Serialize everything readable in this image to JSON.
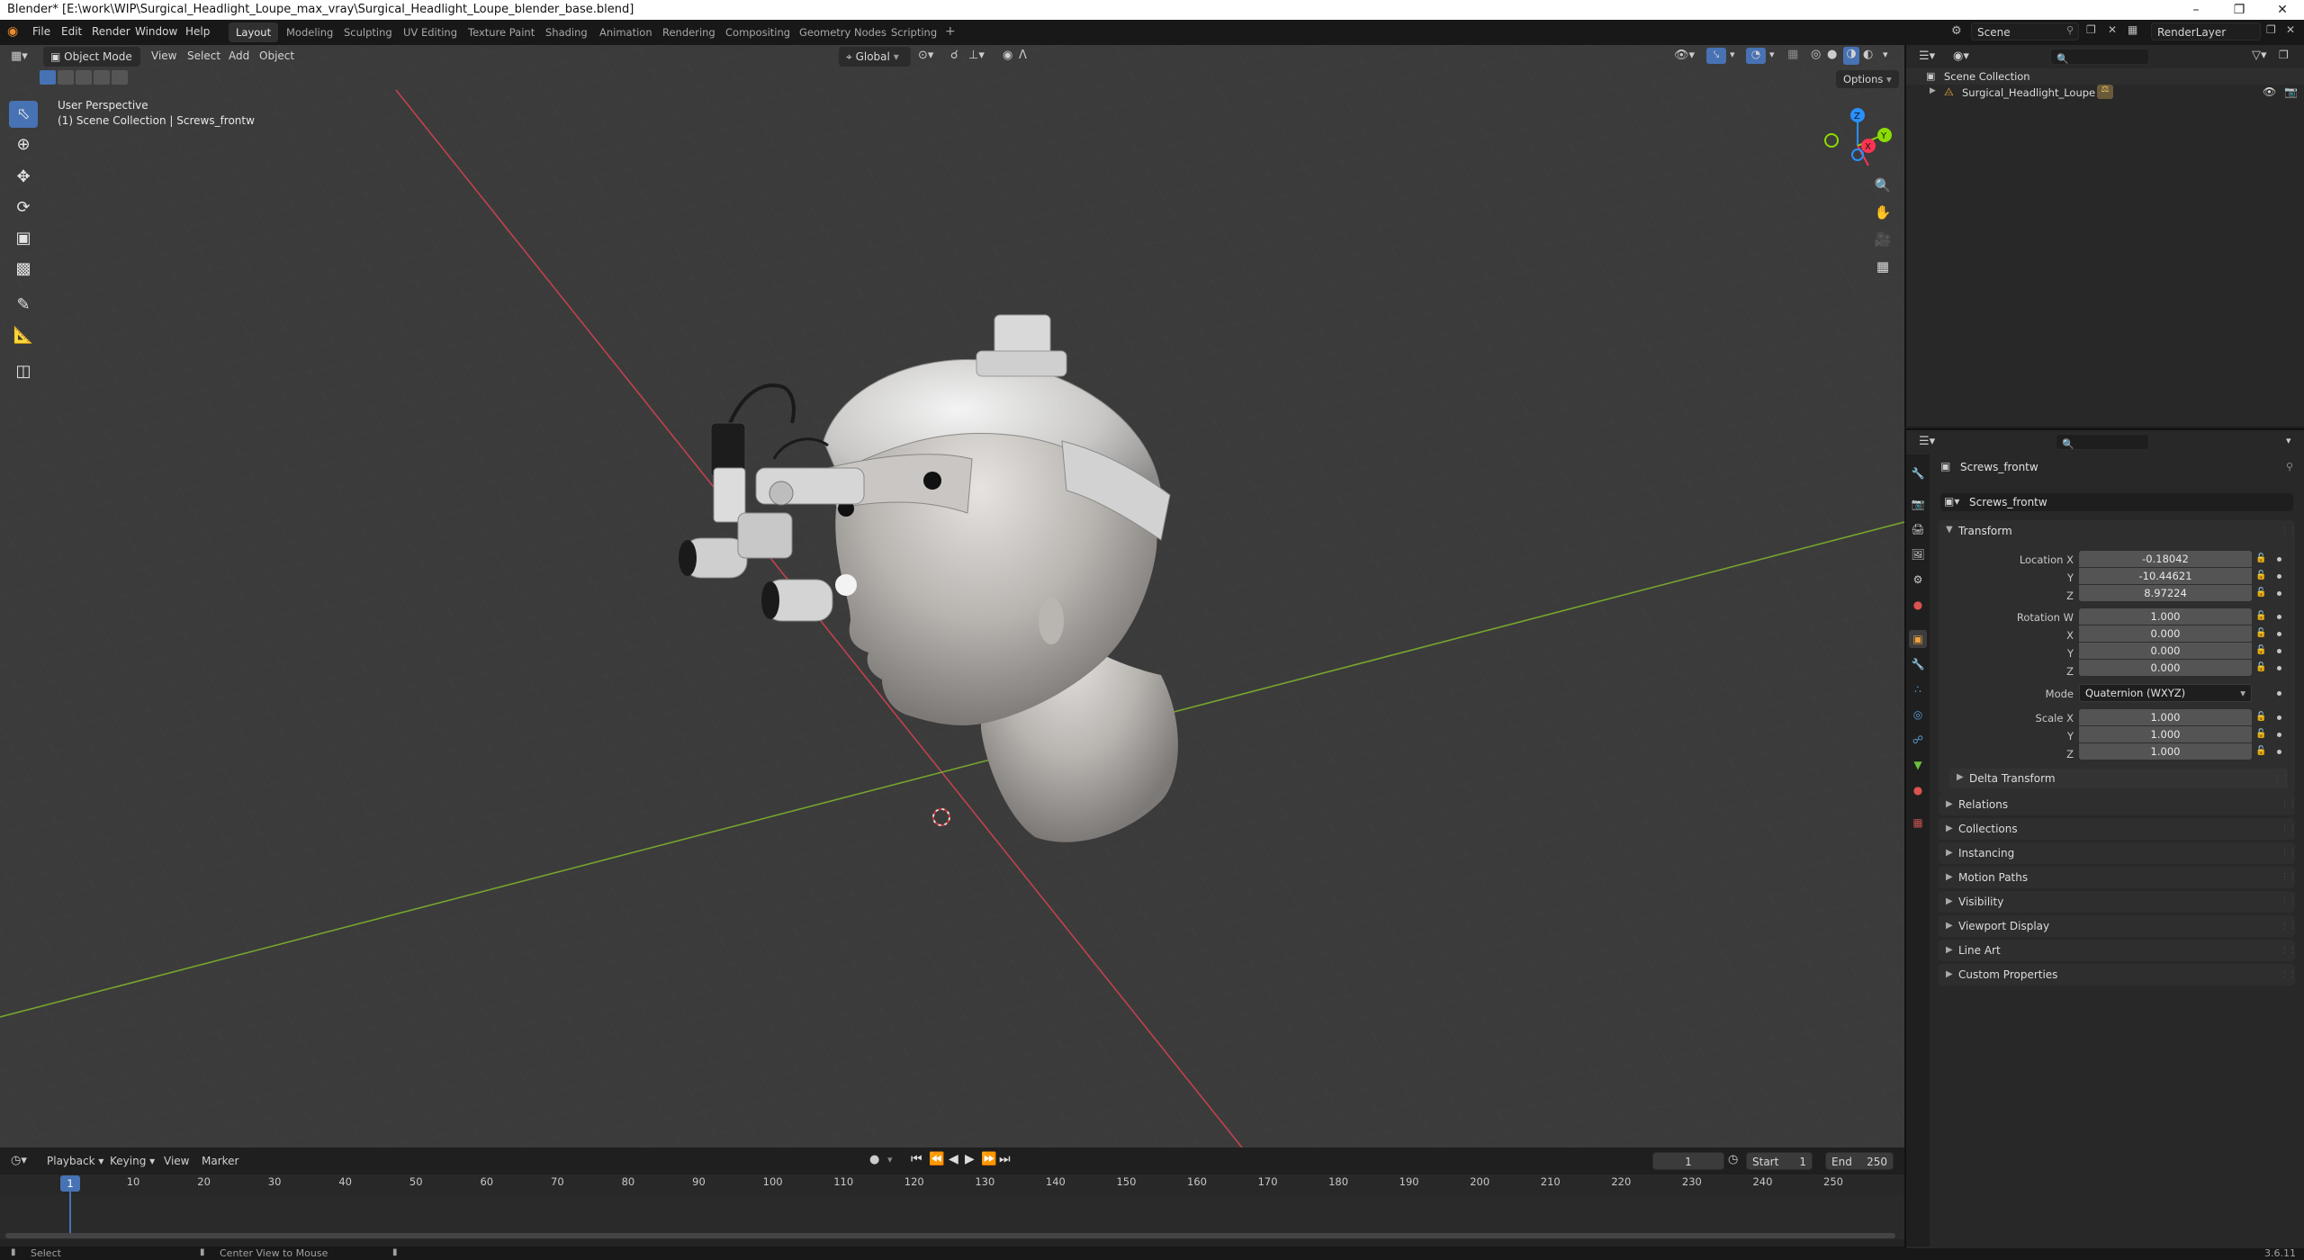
{
  "window": {
    "title": "Blender* [E:\\work\\WIP\\Surgical_Headlight_Loupe_max_vray\\Surgical_Headlight_Loupe_blender_base.blend]",
    "controls": [
      "minimize",
      "maximize",
      "close"
    ]
  },
  "menu": [
    "File",
    "Edit",
    "Render",
    "Window",
    "Help"
  ],
  "workspaces": [
    "Layout",
    "Modeling",
    "Sculpting",
    "UV Editing",
    "Texture Paint",
    "Shading",
    "Animation",
    "Rendering",
    "Compositing",
    "Geometry Nodes",
    "Scripting"
  ],
  "active_workspace": "Layout",
  "scene": {
    "label": "Scene",
    "render_layer": "RenderLayer"
  },
  "viewport": {
    "mode": "Object Mode",
    "menus": [
      "View",
      "Select",
      "Add",
      "Object"
    ],
    "orientation": "Global",
    "options_label": "Options",
    "info_line1": "User Perspective",
    "info_line2": "(1) Scene Collection | Screws_frontw",
    "gizmo_axes": [
      "Z",
      "Y",
      "X"
    ],
    "tools": [
      "select-box",
      "cursor",
      "move",
      "rotate",
      "scale",
      "transform",
      "annotate",
      "measure",
      "add-cube"
    ],
    "nav_icons": [
      "zoom",
      "pan",
      "camera",
      "perspective"
    ]
  },
  "timeline": {
    "menus": [
      "Playback",
      "Keying",
      "View",
      "Marker"
    ],
    "current_frame": "1",
    "start_label": "Start",
    "start_value": "1",
    "end_label": "End",
    "end_value": "250",
    "ruler": [
      "1",
      "10",
      "20",
      "30",
      "40",
      "50",
      "60",
      "70",
      "80",
      "90",
      "100",
      "110",
      "120",
      "130",
      "140",
      "150",
      "160",
      "170",
      "180",
      "190",
      "200",
      "210",
      "220",
      "230",
      "240",
      "250"
    ]
  },
  "statusbar": {
    "left": "Select",
    "middle": "Center View to Mouse",
    "version": "3.6.11"
  },
  "outliner": {
    "root": "Scene Collection",
    "items": [
      "Surgical_Headlight_Loupe"
    ]
  },
  "properties": {
    "object_name": "Screws_frontw",
    "data_name": "Screws_frontw",
    "transform_header": "Transform",
    "location_label": "Location X",
    "location": [
      "-0.18042",
      "-10.44621",
      "8.97224"
    ],
    "rotation_label": "Rotation W",
    "rotation": [
      "1.000",
      "0.000",
      "0.000",
      "0.000"
    ],
    "mode_label": "Mode",
    "mode_value": "Quaternion (WXYZ)",
    "scale_label": "Scale X",
    "scale": [
      "1.000",
      "1.000",
      "1.000"
    ],
    "axis_labels": [
      "X",
      "Y",
      "Z"
    ],
    "sub_panel": "Delta Transform",
    "panels": [
      "Relations",
      "Collections",
      "Instancing",
      "Motion Paths",
      "Visibility",
      "Viewport Display",
      "Line Art",
      "Custom Properties"
    ]
  },
  "colors": {
    "accent": "#4772b3",
    "x_axis": "#ff3352",
    "y_axis": "#8bdc00",
    "z_axis": "#2890ff"
  }
}
